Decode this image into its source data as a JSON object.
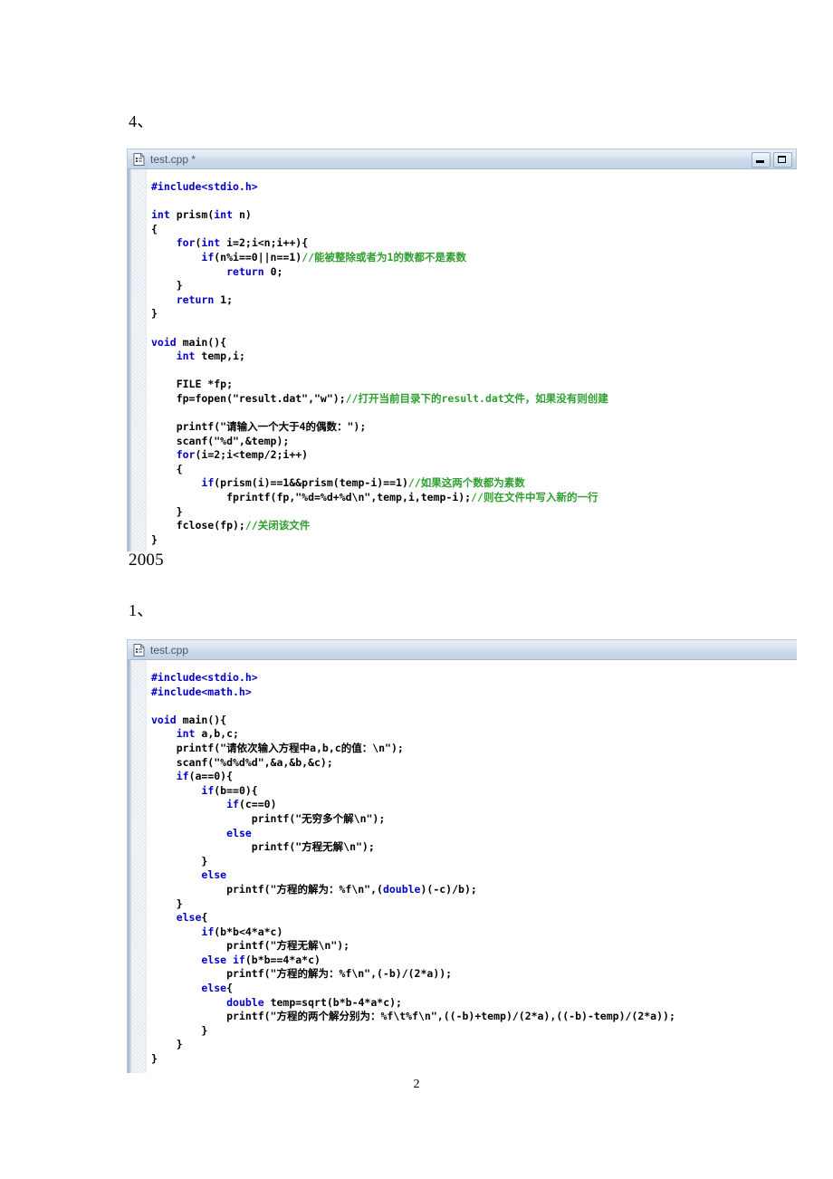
{
  "document": {
    "heading_1": "4、",
    "year_heading": "2005",
    "heading_2": "1、",
    "page_number": "2"
  },
  "editor_windows": [
    {
      "name": "editor-window-1",
      "title": "test.cpp *",
      "icon": "cpp-file-icon",
      "buttons": [
        {
          "name": "minimize-button",
          "glyph": "minimize"
        },
        {
          "name": "maximize-button",
          "glyph": "maximize"
        }
      ],
      "code_lines": [
        [
          {
            "t": "#include<stdio.h>",
            "c": "pp"
          }
        ],
        [],
        [
          {
            "t": "int",
            "c": "kw"
          },
          {
            "t": " prism(",
            "c": "pl"
          },
          {
            "t": "int",
            "c": "kw"
          },
          {
            "t": " n)",
            "c": "pl"
          }
        ],
        [
          {
            "t": "{",
            "c": "pl"
          }
        ],
        [
          {
            "t": "    ",
            "c": "pl"
          },
          {
            "t": "for",
            "c": "kw"
          },
          {
            "t": "(",
            "c": "pl"
          },
          {
            "t": "int",
            "c": "kw"
          },
          {
            "t": " i=2;i<n;i++){",
            "c": "pl"
          }
        ],
        [
          {
            "t": "        ",
            "c": "pl"
          },
          {
            "t": "if",
            "c": "kw"
          },
          {
            "t": "(n%i==0||n==1)",
            "c": "pl"
          },
          {
            "t": "//能被整除或者为1的数都不是素数",
            "c": "cm"
          }
        ],
        [
          {
            "t": "            ",
            "c": "pl"
          },
          {
            "t": "return",
            "c": "kw"
          },
          {
            "t": " 0;",
            "c": "pl"
          }
        ],
        [
          {
            "t": "    }",
            "c": "pl"
          }
        ],
        [
          {
            "t": "    ",
            "c": "pl"
          },
          {
            "t": "return",
            "c": "kw"
          },
          {
            "t": " 1;",
            "c": "pl"
          }
        ],
        [
          {
            "t": "}",
            "c": "pl"
          }
        ],
        [],
        [
          {
            "t": "void",
            "c": "kw"
          },
          {
            "t": " main(){",
            "c": "pl"
          }
        ],
        [
          {
            "t": "    ",
            "c": "pl"
          },
          {
            "t": "int",
            "c": "kw"
          },
          {
            "t": " temp,i;",
            "c": "pl"
          }
        ],
        [],
        [
          {
            "t": "    FILE *fp;",
            "c": "pl"
          }
        ],
        [
          {
            "t": "    fp=fopen(\"result.dat\",\"w\");",
            "c": "pl"
          },
          {
            "t": "//打开当前目录下的result.dat文件，如果没有则创建",
            "c": "cm"
          }
        ],
        [],
        [
          {
            "t": "    printf(\"请输入一个大于4的偶数：\");",
            "c": "pl"
          }
        ],
        [
          {
            "t": "    scanf(\"%d\",&temp);",
            "c": "pl"
          }
        ],
        [
          {
            "t": "    ",
            "c": "pl"
          },
          {
            "t": "for",
            "c": "kw"
          },
          {
            "t": "(i=2;i<temp/2;i++)",
            "c": "pl"
          }
        ],
        [
          {
            "t": "    {",
            "c": "pl"
          }
        ],
        [
          {
            "t": "        ",
            "c": "pl"
          },
          {
            "t": "if",
            "c": "kw"
          },
          {
            "t": "(prism(i)==1&&prism(temp-i)==1)",
            "c": "pl"
          },
          {
            "t": "//如果这两个数都为素数",
            "c": "cm"
          }
        ],
        [
          {
            "t": "            fprintf(fp,\"%d=%d+%d\\n\",temp,i,temp-i);",
            "c": "pl"
          },
          {
            "t": "//则在文件中写入新的一行",
            "c": "cm"
          }
        ],
        [
          {
            "t": "    }",
            "c": "pl"
          }
        ],
        [
          {
            "t": "    fclose(fp);",
            "c": "pl"
          },
          {
            "t": "//关闭该文件",
            "c": "cm"
          }
        ],
        [
          {
            "t": "}",
            "c": "pl"
          }
        ]
      ]
    },
    {
      "name": "editor-window-2",
      "title": "test.cpp",
      "icon": "cpp-file-icon",
      "buttons": [],
      "code_lines": [
        [
          {
            "t": "#include<stdio.h>",
            "c": "pp"
          }
        ],
        [
          {
            "t": "#include<math.h>",
            "c": "pp"
          }
        ],
        [],
        [
          {
            "t": "void",
            "c": "kw"
          },
          {
            "t": " main(){",
            "c": "pl"
          }
        ],
        [
          {
            "t": "    ",
            "c": "pl"
          },
          {
            "t": "int",
            "c": "kw"
          },
          {
            "t": " a,b,c;",
            "c": "pl"
          }
        ],
        [
          {
            "t": "    printf(\"请依次输入方程中a,b,c的值：\\n\");",
            "c": "pl"
          }
        ],
        [
          {
            "t": "    scanf(\"%d%d%d\",&a,&b,&c);",
            "c": "pl"
          }
        ],
        [
          {
            "t": "    ",
            "c": "pl"
          },
          {
            "t": "if",
            "c": "kw"
          },
          {
            "t": "(a==0){",
            "c": "pl"
          }
        ],
        [
          {
            "t": "        ",
            "c": "pl"
          },
          {
            "t": "if",
            "c": "kw"
          },
          {
            "t": "(b==0){",
            "c": "pl"
          }
        ],
        [
          {
            "t": "            ",
            "c": "pl"
          },
          {
            "t": "if",
            "c": "kw"
          },
          {
            "t": "(c==0)",
            "c": "pl"
          }
        ],
        [
          {
            "t": "                printf(\"无穷多个解\\n\");",
            "c": "pl"
          }
        ],
        [
          {
            "t": "            ",
            "c": "pl"
          },
          {
            "t": "else",
            "c": "kw"
          }
        ],
        [
          {
            "t": "                printf(\"方程无解\\n\");",
            "c": "pl"
          }
        ],
        [
          {
            "t": "        }",
            "c": "pl"
          }
        ],
        [
          {
            "t": "        ",
            "c": "pl"
          },
          {
            "t": "else",
            "c": "kw"
          }
        ],
        [
          {
            "t": "            printf(\"方程的解为：%f\\n\",(",
            "c": "pl"
          },
          {
            "t": "double",
            "c": "kw"
          },
          {
            "t": ")(-c)/b);",
            "c": "pl"
          }
        ],
        [
          {
            "t": "    }",
            "c": "pl"
          }
        ],
        [
          {
            "t": "    ",
            "c": "pl"
          },
          {
            "t": "else",
            "c": "kw"
          },
          {
            "t": "{",
            "c": "pl"
          }
        ],
        [
          {
            "t": "        ",
            "c": "pl"
          },
          {
            "t": "if",
            "c": "kw"
          },
          {
            "t": "(b*b<4*a*c)",
            "c": "pl"
          }
        ],
        [
          {
            "t": "            printf(\"方程无解\\n\");",
            "c": "pl"
          }
        ],
        [
          {
            "t": "        ",
            "c": "pl"
          },
          {
            "t": "else if",
            "c": "kw"
          },
          {
            "t": "(b*b==4*a*c)",
            "c": "pl"
          }
        ],
        [
          {
            "t": "            printf(\"方程的解为：%f\\n\",(-b)/(2*a));",
            "c": "pl"
          }
        ],
        [
          {
            "t": "        ",
            "c": "pl"
          },
          {
            "t": "else",
            "c": "kw"
          },
          {
            "t": "{",
            "c": "pl"
          }
        ],
        [
          {
            "t": "            ",
            "c": "pl"
          },
          {
            "t": "double",
            "c": "kw"
          },
          {
            "t": " temp=sqrt(b*b-4*a*c);",
            "c": "pl"
          }
        ],
        [
          {
            "t": "            printf(\"方程的两个解分别为：%f\\t%f\\n\",((-b)+temp)/(2*a),((-b)-temp)/(2*a));",
            "c": "pl"
          }
        ],
        [
          {
            "t": "        }",
            "c": "pl"
          }
        ],
        [
          {
            "t": "    }",
            "c": "pl"
          }
        ],
        [
          {
            "t": "}",
            "c": "pl"
          }
        ]
      ]
    }
  ],
  "colors": {
    "keyword": "#0000c8",
    "comment": "#2f9f2f",
    "plain": "#000000",
    "titlebar_start": "#e8eef7",
    "titlebar_end": "#c3d3e6",
    "gutter": "#9fb6ce"
  }
}
